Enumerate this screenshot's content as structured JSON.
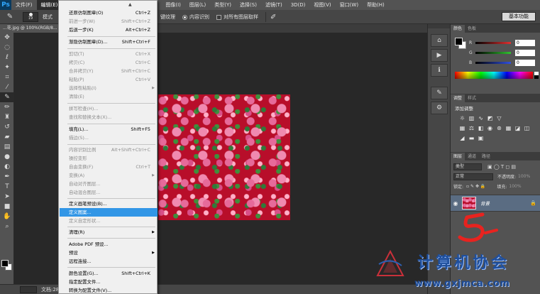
{
  "app": {
    "logo": "Ps"
  },
  "menubar": {
    "items": [
      "文件(F)",
      "编辑(E)",
      "图像(I)",
      "图层(L)",
      "类型(Y)",
      "选择(S)",
      "滤镜(T)",
      "3D(D)",
      "视图(V)",
      "窗口(W)",
      "帮助(H)"
    ],
    "active_index": 1
  },
  "options_bar": {
    "brush_size": "19",
    "mode_label": "模式",
    "source_label": "键纹理",
    "content_aware_label": "内容识别",
    "sample_all_label": "对所有图层取样",
    "workspace_label": "基本功能"
  },
  "document": {
    "tab_title": "...花.jpg @ 100%(RGB/8...",
    "status_text": "文档:28..."
  },
  "edit_menu": {
    "items": [
      {
        "label": "还原仿制图章(O)",
        "shortcut": "Ctrl+Z",
        "disabled": false
      },
      {
        "label": "前进一步(W)",
        "shortcut": "Shift+Ctrl+Z",
        "disabled": true
      },
      {
        "label": "后退一步(K)",
        "shortcut": "Alt+Ctrl+Z",
        "disabled": false
      },
      {
        "label": "渐隐仿制图章(D)...",
        "shortcut": "Shift+Ctrl+F",
        "disabled": false
      },
      {
        "label": "剪切(T)",
        "shortcut": "Ctrl+X",
        "disabled": true
      },
      {
        "label": "拷贝(C)",
        "shortcut": "Ctrl+C",
        "disabled": true
      },
      {
        "label": "合并拷贝(Y)",
        "shortcut": "Shift+Ctrl+C",
        "disabled": true
      },
      {
        "label": "粘贴(P)",
        "shortcut": "Ctrl+V",
        "disabled": true
      },
      {
        "label": "选择性粘贴(I)",
        "shortcut": "",
        "submenu": true,
        "disabled": true
      },
      {
        "label": "清除(E)",
        "shortcut": "",
        "disabled": true
      },
      {
        "label": "拼写检查(H)...",
        "shortcut": "",
        "disabled": true
      },
      {
        "label": "查找和替换文本(X)...",
        "shortcut": "",
        "disabled": true
      },
      {
        "label": "填充(L)...",
        "shortcut": "Shift+F5",
        "disabled": false
      },
      {
        "label": "描边(S)...",
        "shortcut": "",
        "disabled": true
      },
      {
        "label": "内容识别比例",
        "shortcut": "Alt+Shift+Ctrl+C",
        "disabled": true
      },
      {
        "label": "操控变形",
        "shortcut": "",
        "disabled": true
      },
      {
        "label": "自由变换(F)",
        "shortcut": "Ctrl+T",
        "disabled": true
      },
      {
        "label": "变换(A)",
        "shortcut": "",
        "submenu": true,
        "disabled": true
      },
      {
        "label": "自动对齐图层...",
        "shortcut": "",
        "disabled": true
      },
      {
        "label": "自动混合图层...",
        "shortcut": "",
        "disabled": true
      },
      {
        "label": "定义画笔预设(B)...",
        "shortcut": "",
        "disabled": false
      },
      {
        "label": "定义图案...",
        "shortcut": "",
        "disabled": false,
        "highlight": true
      },
      {
        "label": "定义自定形状...",
        "shortcut": "",
        "disabled": true
      },
      {
        "label": "清理(R)",
        "shortcut": "",
        "submenu": true,
        "disabled": false
      },
      {
        "label": "Adobe PDF 预设...",
        "shortcut": "",
        "disabled": false
      },
      {
        "label": "预设",
        "shortcut": "",
        "submenu": true,
        "disabled": false
      },
      {
        "label": "远程连接...",
        "shortcut": "",
        "disabled": false
      },
      {
        "label": "颜色设置(G)...",
        "shortcut": "Shift+Ctrl+K",
        "disabled": false
      },
      {
        "label": "指定配置文件...",
        "shortcut": "",
        "disabled": false
      },
      {
        "label": "转换为配置文件(V)...",
        "shortcut": "",
        "disabled": false
      }
    ]
  },
  "color_panel": {
    "tabs": [
      "颜色",
      "色板"
    ],
    "channels": [
      {
        "label": "R",
        "value": "0",
        "color": "#e03030"
      },
      {
        "label": "G",
        "value": "0",
        "color": "#30c030"
      },
      {
        "label": "B",
        "value": "0",
        "color": "#3050e0"
      }
    ]
  },
  "adjustments_panel": {
    "tabs": [
      "调整",
      "样式"
    ],
    "title": "添加调整"
  },
  "layers_panel": {
    "tabs": [
      "图层",
      "通道",
      "路径"
    ],
    "filter_label": "类型",
    "blend_mode": "正常",
    "opacity_label": "不透明度:",
    "opacity_value": "100%",
    "lock_label": "锁定:",
    "fill_label": "填充:",
    "fill_value": "100%",
    "layer_name": "背景"
  },
  "watermark": {
    "title": "计算机协会",
    "url": "www.gxjmca.com"
  }
}
